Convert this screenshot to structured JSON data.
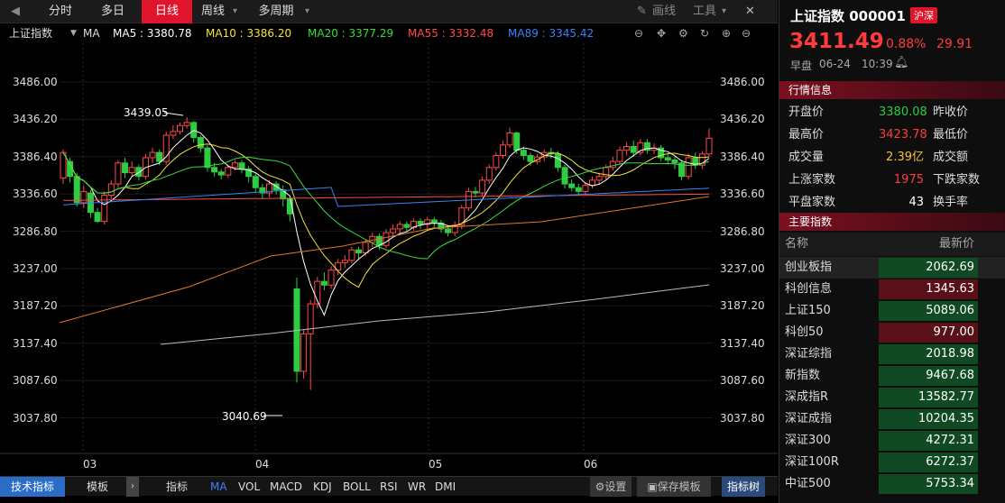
{
  "topbar": {
    "tabs": [
      "分时",
      "多日",
      "日线",
      "周线",
      "多周期"
    ],
    "active": "日线",
    "draw_label": "画线",
    "tools_label": "工具"
  },
  "ma_bar": {
    "index_name": "上证指数",
    "ma_label": "MA",
    "ma5": "MA5 : 3380.78",
    "ma10": "MA10 : 3386.20",
    "ma20": "MA20 : 3377.29",
    "ma55": "MA55 : 3332.48",
    "ma89": "MA89 : 3345.42",
    "colors": {
      "ma5": "#ffffff",
      "ma10": "#f5e23b",
      "ma20": "#3cdc3c",
      "ma55": "#ff4a4a",
      "ma89": "#3b82f6"
    }
  },
  "chart_data": {
    "type": "candlestick",
    "y_ticks": [
      "3486.00",
      "3436.20",
      "3386.40",
      "3336.60",
      "3286.80",
      "3237.00",
      "3187.20",
      "3137.40",
      "3087.60",
      "3037.80"
    ],
    "ylim": [
      3000,
      3510
    ],
    "x_ticks": [
      "03",
      "04",
      "05",
      "06"
    ],
    "high_label": "3439.05",
    "low_label": "3040.69",
    "candles": [
      [
        3358,
        3392,
        3350,
        3396
      ],
      [
        3380,
        3360,
        3352,
        3385
      ],
      [
        3360,
        3325,
        3320,
        3365
      ],
      [
        3325,
        3340,
        3318,
        3348
      ],
      [
        3338,
        3312,
        3305,
        3342
      ],
      [
        3312,
        3300,
        3298,
        3318
      ],
      [
        3300,
        3335,
        3296,
        3340
      ],
      [
        3335,
        3350,
        3330,
        3355
      ],
      [
        3350,
        3378,
        3345,
        3382
      ],
      [
        3378,
        3365,
        3358,
        3385
      ],
      [
        3365,
        3372,
        3360,
        3380
      ],
      [
        3372,
        3360,
        3355,
        3376
      ],
      [
        3360,
        3385,
        3356,
        3390
      ],
      [
        3385,
        3392,
        3378,
        3398
      ],
      [
        3392,
        3380,
        3375,
        3396
      ],
      [
        3380,
        3415,
        3376,
        3420
      ],
      [
        3415,
        3420,
        3410,
        3428
      ],
      [
        3420,
        3428,
        3416,
        3432
      ],
      [
        3428,
        3432,
        3424,
        3439
      ],
      [
        3432,
        3412,
        3405,
        3434
      ],
      [
        3412,
        3398,
        3392,
        3415
      ],
      [
        3398,
        3372,
        3366,
        3402
      ],
      [
        3372,
        3366,
        3360,
        3378
      ],
      [
        3366,
        3362,
        3356,
        3370
      ],
      [
        3362,
        3372,
        3358,
        3376
      ],
      [
        3372,
        3378,
        3368,
        3382
      ],
      [
        3378,
        3370,
        3364,
        3382
      ],
      [
        3370,
        3360,
        3352,
        3374
      ],
      [
        3360,
        3345,
        3338,
        3364
      ],
      [
        3345,
        3338,
        3330,
        3350
      ],
      [
        3338,
        3350,
        3332,
        3355
      ],
      [
        3350,
        3342,
        3336,
        3354
      ],
      [
        3342,
        3330,
        3320,
        3348
      ],
      [
        3330,
        3310,
        3300,
        3334
      ],
      [
        3210,
        3100,
        3085,
        3225
      ],
      [
        3100,
        3150,
        3090,
        3155
      ],
      [
        3150,
        3190,
        3075,
        3195
      ],
      [
        3190,
        3220,
        3184,
        3226
      ],
      [
        3220,
        3215,
        3208,
        3232
      ],
      [
        3215,
        3235,
        3210,
        3240
      ],
      [
        3235,
        3245,
        3228,
        3250
      ],
      [
        3245,
        3248,
        3238,
        3255
      ],
      [
        3248,
        3262,
        3244,
        3266
      ],
      [
        3262,
        3258,
        3250,
        3266
      ],
      [
        3258,
        3272,
        3254,
        3276
      ],
      [
        3272,
        3280,
        3266,
        3285
      ],
      [
        3280,
        3268,
        3262,
        3284
      ],
      [
        3268,
        3285,
        3264,
        3290
      ],
      [
        3285,
        3290,
        3280,
        3296
      ],
      [
        3290,
        3296,
        3284,
        3300
      ],
      [
        3296,
        3292,
        3286,
        3300
      ],
      [
        3292,
        3300,
        3288,
        3304
      ],
      [
        3300,
        3296,
        3290,
        3304
      ],
      [
        3296,
        3302,
        3290,
        3306
      ],
      [
        3302,
        3298,
        3292,
        3306
      ],
      [
        3298,
        3290,
        3285,
        3302
      ],
      [
        3290,
        3285,
        3280,
        3295
      ],
      [
        3285,
        3295,
        3280,
        3300
      ],
      [
        3295,
        3318,
        3290,
        3322
      ],
      [
        3318,
        3340,
        3314,
        3345
      ],
      [
        3340,
        3338,
        3332,
        3346
      ],
      [
        3338,
        3355,
        3334,
        3360
      ],
      [
        3355,
        3372,
        3350,
        3376
      ],
      [
        3372,
        3388,
        3368,
        3392
      ],
      [
        3388,
        3402,
        3384,
        3408
      ],
      [
        3402,
        3418,
        3398,
        3425
      ],
      [
        3418,
        3395,
        3390,
        3420
      ],
      [
        3395,
        3388,
        3382,
        3400
      ],
      [
        3388,
        3380,
        3374,
        3392
      ],
      [
        3380,
        3386,
        3376,
        3390
      ],
      [
        3386,
        3392,
        3380,
        3396
      ],
      [
        3392,
        3390,
        3384,
        3398
      ],
      [
        3390,
        3372,
        3366,
        3394
      ],
      [
        3372,
        3350,
        3344,
        3376
      ],
      [
        3350,
        3345,
        3340,
        3356
      ],
      [
        3345,
        3340,
        3335,
        3350
      ],
      [
        3340,
        3348,
        3336,
        3352
      ],
      [
        3348,
        3355,
        3344,
        3360
      ],
      [
        3355,
        3360,
        3350,
        3365
      ],
      [
        3360,
        3372,
        3356,
        3376
      ],
      [
        3372,
        3380,
        3368,
        3386
      ],
      [
        3380,
        3395,
        3376,
        3400
      ],
      [
        3395,
        3400,
        3388,
        3406
      ],
      [
        3400,
        3392,
        3386,
        3408
      ],
      [
        3392,
        3405,
        3388,
        3410
      ],
      [
        3405,
        3395,
        3390,
        3410
      ],
      [
        3395,
        3398,
        3390,
        3404
      ],
      [
        3398,
        3385,
        3380,
        3402
      ],
      [
        3385,
        3382,
        3376,
        3390
      ],
      [
        3382,
        3378,
        3370,
        3386
      ],
      [
        3378,
        3360,
        3355,
        3382
      ],
      [
        3360,
        3385,
        3356,
        3390
      ],
      [
        3385,
        3375,
        3370,
        3392
      ],
      [
        3375,
        3390,
        3370,
        3394
      ],
      [
        3390,
        3411,
        3386,
        3424
      ]
    ]
  },
  "bottombar": {
    "tech_label": "技术指标",
    "template_label": "模板",
    "indicator_label": "指标",
    "indicators": [
      "MA",
      "VOL",
      "MACD",
      "KDJ",
      "BOLL",
      "RSI",
      "WR",
      "DMI"
    ],
    "settings_label": "设置",
    "save_template_label": "保存模板",
    "indicator_tree_label": "指标树"
  },
  "quote": {
    "title": "上证指数 000001",
    "exchange": "沪深",
    "price": "3411.49",
    "change_pct": "0.88%",
    "change": "29.91",
    "session": "早盘",
    "date": "06-24",
    "time": "10:39"
  },
  "market_info": {
    "section_title": "行情信息",
    "open_label": "开盘价",
    "open_value": "3380.08",
    "prev_close_label": "昨收价",
    "high_label": "最高价",
    "high_value": "3423.78",
    "low_label": "最低价",
    "volume_label": "成交量",
    "volume_value": "2.39亿",
    "amount_label": "成交额",
    "up_label": "上涨家数",
    "up_value": "1975",
    "down_label": "下跌家数",
    "flat_label": "平盘家数",
    "flat_value": "43",
    "turnover_label": "换手率"
  },
  "indices": {
    "section_title": "主要指数",
    "col_name": "名称",
    "col_price": "最新价",
    "rows": [
      {
        "name": "创业板指",
        "price": "2062.69",
        "bg": "#0f4a22"
      },
      {
        "name": "科创信息",
        "price": "1345.63",
        "bg": "#5a1018"
      },
      {
        "name": "上证150",
        "price": "5089.06",
        "bg": "#0f4a22"
      },
      {
        "name": "科创50",
        "price": "977.00",
        "bg": "#5a1018"
      },
      {
        "name": "深证综指",
        "price": "2018.98",
        "bg": "#0f4a22"
      },
      {
        "name": "新指数",
        "price": "9467.68",
        "bg": "#0f4a22"
      },
      {
        "name": "深成指R",
        "price": "13582.77",
        "bg": "#0f4a22"
      },
      {
        "name": "深证成指",
        "price": "10204.35",
        "bg": "#0f4a22"
      },
      {
        "name": "深证300",
        "price": "4272.31",
        "bg": "#0f4a22"
      },
      {
        "name": "深证100R",
        "price": "6272.37",
        "bg": "#0f4a22"
      },
      {
        "name": "中证500",
        "price": "5753.34",
        "bg": "#0f4a22"
      }
    ]
  }
}
